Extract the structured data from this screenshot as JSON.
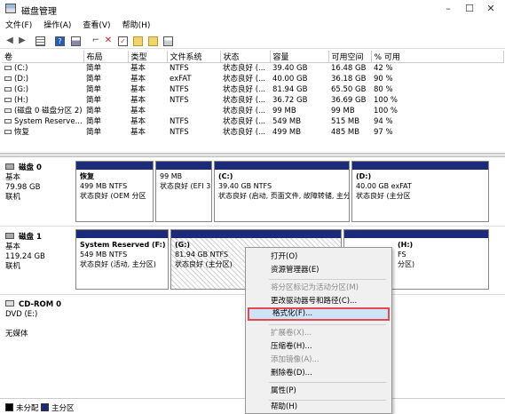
{
  "window": {
    "title": "磁盘管理",
    "minimize": "–",
    "maximize": "☐",
    "close": "✕"
  },
  "menu": [
    "文件(F)",
    "操作(A)",
    "查看(V)",
    "帮助(H)"
  ],
  "toolbar_icons": [
    "back-icon",
    "forward-icon",
    "list-icon",
    "help-icon",
    "properties-icon",
    "delete-icon",
    "check-icon",
    "folder-icon",
    "search-icon"
  ],
  "volume_table": {
    "headers": [
      "卷",
      "布局",
      "类型",
      "文件系统",
      "状态",
      "容量",
      "可用空间",
      "% 可用"
    ],
    "rows": [
      [
        "(C:)",
        "简单",
        "基本",
        "NTFS",
        "状态良好 (...",
        "39.40 GB",
        "16.48 GB",
        "42 %"
      ],
      [
        "(D:)",
        "简单",
        "基本",
        "exFAT",
        "状态良好 (...",
        "40.00 GB",
        "36.18 GB",
        "90 %"
      ],
      [
        "(G:)",
        "简单",
        "基本",
        "NTFS",
        "状态良好 (...",
        "81.94 GB",
        "65.50 GB",
        "80 %"
      ],
      [
        "(H:)",
        "简单",
        "基本",
        "NTFS",
        "状态良好 (...",
        "36.72 GB",
        "36.69 GB",
        "100 %"
      ],
      [
        "(磁盘 0 磁盘分区 2)",
        "简单",
        "基本",
        "",
        "状态良好 (...",
        "99 MB",
        "99 MB",
        "100 %"
      ],
      [
        "System Reserve...",
        "简单",
        "基本",
        "NTFS",
        "状态良好 (...",
        "549 MB",
        "515 MB",
        "94 %"
      ],
      [
        "恢复",
        "简单",
        "基本",
        "NTFS",
        "状态良好 (...",
        "499 MB",
        "485 MB",
        "97 %"
      ]
    ]
  },
  "disks": [
    {
      "name": "磁盘 0",
      "type": "基本",
      "size": "79.98 GB",
      "status": "联机",
      "partitions": [
        {
          "name": "恢复",
          "size": "499 MB NTFS",
          "status": "状态良好 (OEM 分区"
        },
        {
          "name": "",
          "size": "99 MB",
          "status": "状态良好 (EFI 3"
        },
        {
          "name": "(C:)",
          "size": "39.40 GB NTFS",
          "status": "状态良好 (启动, 页面文件, 故障转储, 主分"
        },
        {
          "name": "(D:)",
          "size": "40.00 GB exFAT",
          "status": "状态良好 (主分区"
        }
      ]
    },
    {
      "name": "磁盘 1",
      "type": "基本",
      "size": "119.24 GB",
      "status": "联机",
      "partitions": [
        {
          "name": "System Reserved  (F:)",
          "size": "549 MB NTFS",
          "status": "状态良好 (活动, 主分区)"
        },
        {
          "name": "(G:)",
          "size": "81.94 GB NTFS",
          "status": "状态良好 (主分区)"
        },
        {
          "name": "(H:)",
          "size": "FS",
          "status": "分区)"
        }
      ]
    },
    {
      "name": "CD-ROM 0",
      "type": "DVD (E:)",
      "size": "",
      "status": "无媒体"
    }
  ],
  "legend": [
    {
      "label": "未分配",
      "color": "#000000"
    },
    {
      "label": "主分区",
      "color": "#1c2a7a"
    }
  ],
  "context_menu": [
    {
      "label": "打开(O)",
      "enabled": true
    },
    {
      "label": "资源管理器(E)",
      "enabled": true
    },
    {
      "label": "将分区标记为活动分区(M)",
      "enabled": false
    },
    {
      "label": "更改驱动器号和路径(C)...",
      "enabled": true
    },
    {
      "label": "格式化(F)...",
      "enabled": true,
      "selected": true
    },
    {
      "label": "扩展卷(X)...",
      "enabled": false
    },
    {
      "label": "压缩卷(H)...",
      "enabled": true
    },
    {
      "label": "添加镜像(A)...",
      "enabled": false
    },
    {
      "label": "删除卷(D)...",
      "enabled": true
    },
    {
      "label": "属性(P)",
      "enabled": true
    },
    {
      "label": "帮助(H)",
      "enabled": true
    }
  ]
}
